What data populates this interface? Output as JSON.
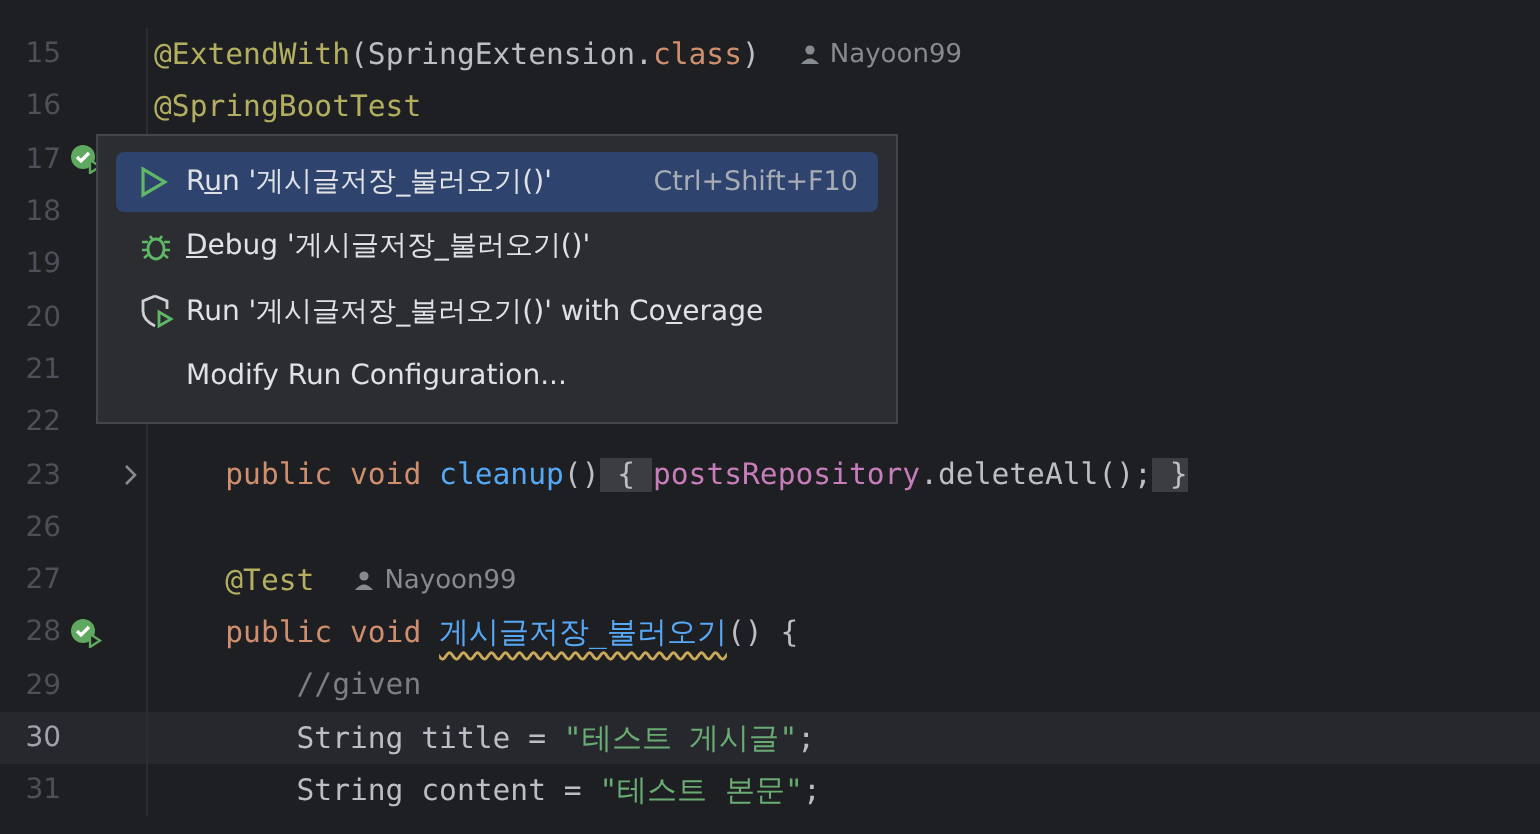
{
  "editor": {
    "lines": [
      {
        "number": "15",
        "current": false,
        "tokens": [
          {
            "kind": "annotation",
            "text": "@ExtendWith"
          },
          {
            "kind": "plain",
            "text": "(SpringExtension."
          },
          {
            "kind": "keyword",
            "text": "class"
          },
          {
            "kind": "plain",
            "text": ")"
          }
        ],
        "author": "Nayoon99"
      },
      {
        "number": "16",
        "current": false,
        "tokens": [
          {
            "kind": "annotation",
            "text": "@SpringBootTest"
          }
        ]
      },
      {
        "number": "17",
        "current": false,
        "test_passed": true
      },
      {
        "number": "18",
        "current": false
      },
      {
        "number": "19",
        "current": false
      },
      {
        "number": "20",
        "current": false
      },
      {
        "number": "21",
        "current": false
      },
      {
        "number": "22",
        "current": false
      },
      {
        "number": "23",
        "current": false,
        "fold": true,
        "tokens": [
          {
            "kind": "keyword",
            "text": "    public void "
          },
          {
            "kind": "method",
            "text": "cleanup"
          },
          {
            "kind": "plain",
            "text": "()"
          },
          {
            "kind": "brace",
            "text": " { "
          },
          {
            "kind": "field",
            "text": "postsRepository"
          },
          {
            "kind": "plain",
            "text": ".deleteAll();"
          },
          {
            "kind": "brace",
            "text": " }"
          }
        ]
      },
      {
        "number": "26",
        "current": false
      },
      {
        "number": "27",
        "current": false,
        "tokens": [
          {
            "kind": "annotation",
            "text": "    @Test"
          }
        ],
        "author": "Nayoon99"
      },
      {
        "number": "28",
        "current": false,
        "test_passed": true,
        "tokens": [
          {
            "kind": "keyword",
            "text": "    public void "
          },
          {
            "kind": "method-warning",
            "text": "게시글저장_불러오기"
          },
          {
            "kind": "plain",
            "text": "() {"
          }
        ]
      },
      {
        "number": "29",
        "current": false,
        "tokens": [
          {
            "kind": "comment",
            "text": "        //given"
          }
        ]
      },
      {
        "number": "30",
        "current": true,
        "tokens": [
          {
            "kind": "plain",
            "text": "        String title = "
          },
          {
            "kind": "string",
            "text": "\"테스트 게시글\""
          },
          {
            "kind": "plain",
            "text": ";"
          }
        ]
      },
      {
        "number": "31",
        "current": false,
        "tokens": [
          {
            "kind": "plain",
            "text": "        String content = "
          },
          {
            "kind": "string",
            "text": "\"테스트 본문\""
          },
          {
            "kind": "plain",
            "text": ";"
          }
        ]
      }
    ]
  },
  "popup_menu": {
    "items": [
      {
        "kind": "run",
        "selected": true,
        "label": [
          {
            "text": "R"
          },
          {
            "text": "u",
            "mnemonic": true
          },
          {
            "text": "n '게시글저장_불러오기()'"
          }
        ],
        "shortcut": "Ctrl+Shift+F10"
      },
      {
        "kind": "debug",
        "selected": false,
        "label": [
          {
            "text": "D",
            "mnemonic": true
          },
          {
            "text": "ebug '게시글저장_불러오기()'"
          }
        ]
      },
      {
        "kind": "coverage",
        "selected": false,
        "label": [
          {
            "text": "Run '게시글저장_불러오기()' with Co"
          },
          {
            "text": "v",
            "mnemonic": true
          },
          {
            "text": "erage"
          }
        ]
      },
      {
        "kind": "plain",
        "selected": false,
        "label": [
          {
            "text": "Modify Run Configuration..."
          }
        ]
      }
    ]
  }
}
